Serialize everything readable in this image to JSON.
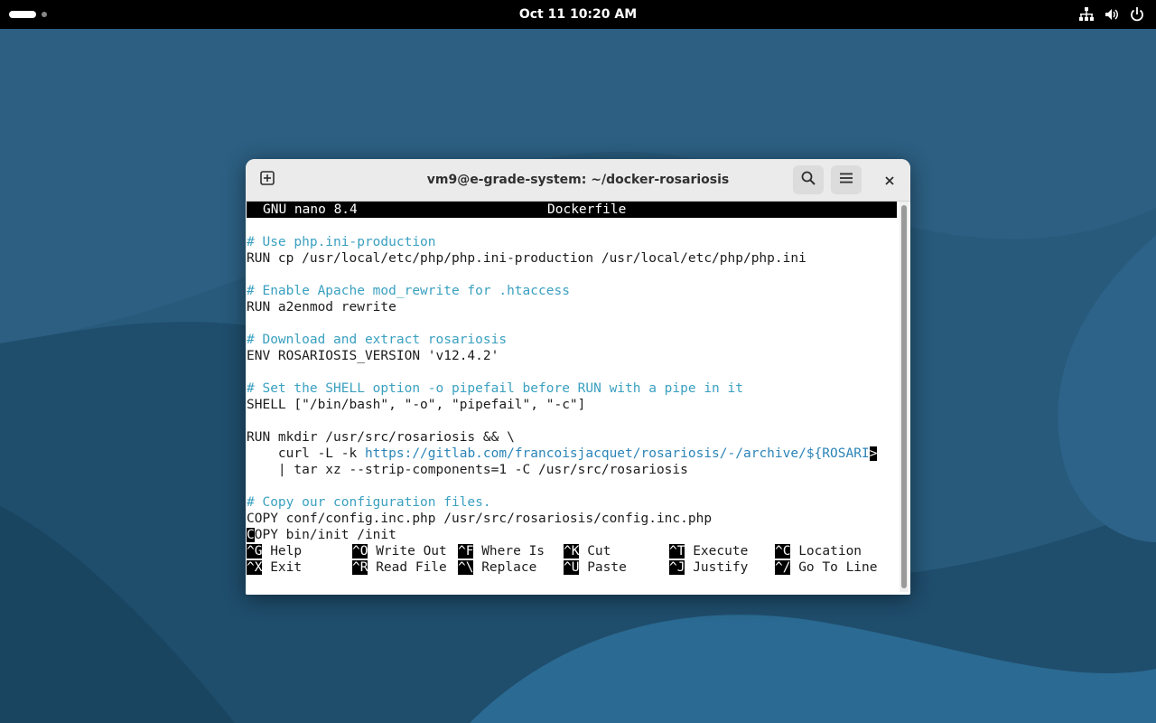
{
  "topbar": {
    "clock": "Oct 11  10:20 AM",
    "icons": [
      "network-icon",
      "volume-icon",
      "power-icon"
    ]
  },
  "window": {
    "title": "vm9@e-grade-system: ~/docker-rosariosis",
    "buttons": [
      "new-tab-icon",
      "search-icon",
      "menu-icon",
      "close-icon"
    ]
  },
  "nano": {
    "version": "GNU nano 8.4",
    "filename": "Dockerfile",
    "lines": [
      {
        "t": "",
        "c": false
      },
      {
        "t": "# Use php.ini-production",
        "c": true
      },
      {
        "t": "RUN cp /usr/local/etc/php/php.ini-production /usr/local/etc/php/php.ini",
        "c": false
      },
      {
        "t": "",
        "c": false
      },
      {
        "t": "# Enable Apache mod_rewrite for .htaccess",
        "c": true
      },
      {
        "t": "RUN a2enmod rewrite",
        "c": false
      },
      {
        "t": "",
        "c": false
      },
      {
        "t": "# Download and extract rosariosis",
        "c": true
      },
      {
        "t": "ENV ROSARIOSIS_VERSION 'v12.4.2'",
        "c": false
      },
      {
        "t": "",
        "c": false
      },
      {
        "t": "# Set the SHELL option -o pipefail before RUN with a pipe in it",
        "c": true
      },
      {
        "t": "SHELL [\"/bin/bash\", \"-o\", \"pipefail\", \"-c\"]",
        "c": false
      },
      {
        "t": "",
        "c": false
      },
      {
        "t": "RUN mkdir /usr/src/rosariosis && \\",
        "c": false
      }
    ],
    "curl_prefix": "    curl -L -k ",
    "curl_url": "https://gitlab.com/francoisjacquet/rosariosis/-/archive/${ROSARI",
    "truncation_marker": ">",
    "tar_line": "    | tar xz --strip-components=1 -C /usr/src/rosariosis",
    "comment_copy": "# Copy our configuration files.",
    "copy_line": "COPY conf/config.inc.php /usr/src/rosariosis/config.inc.php",
    "cursor_char": "C",
    "last_line_rest": "OPY bin/init /init",
    "shortcuts_row1": [
      {
        "key": "^G",
        "label": "Help"
      },
      {
        "key": "^O",
        "label": "Write Out"
      },
      {
        "key": "^F",
        "label": "Where Is"
      },
      {
        "key": "^K",
        "label": "Cut"
      },
      {
        "key": "^T",
        "label": "Execute"
      },
      {
        "key": "^C",
        "label": "Location"
      }
    ],
    "shortcuts_row2": [
      {
        "key": "^X",
        "label": "Exit"
      },
      {
        "key": "^R",
        "label": "Read File"
      },
      {
        "key": "^\\",
        "label": "Replace"
      },
      {
        "key": "^U",
        "label": "Paste"
      },
      {
        "key": "^J",
        "label": "Justify"
      },
      {
        "key": "^/",
        "label": "Go To Line"
      }
    ]
  }
}
